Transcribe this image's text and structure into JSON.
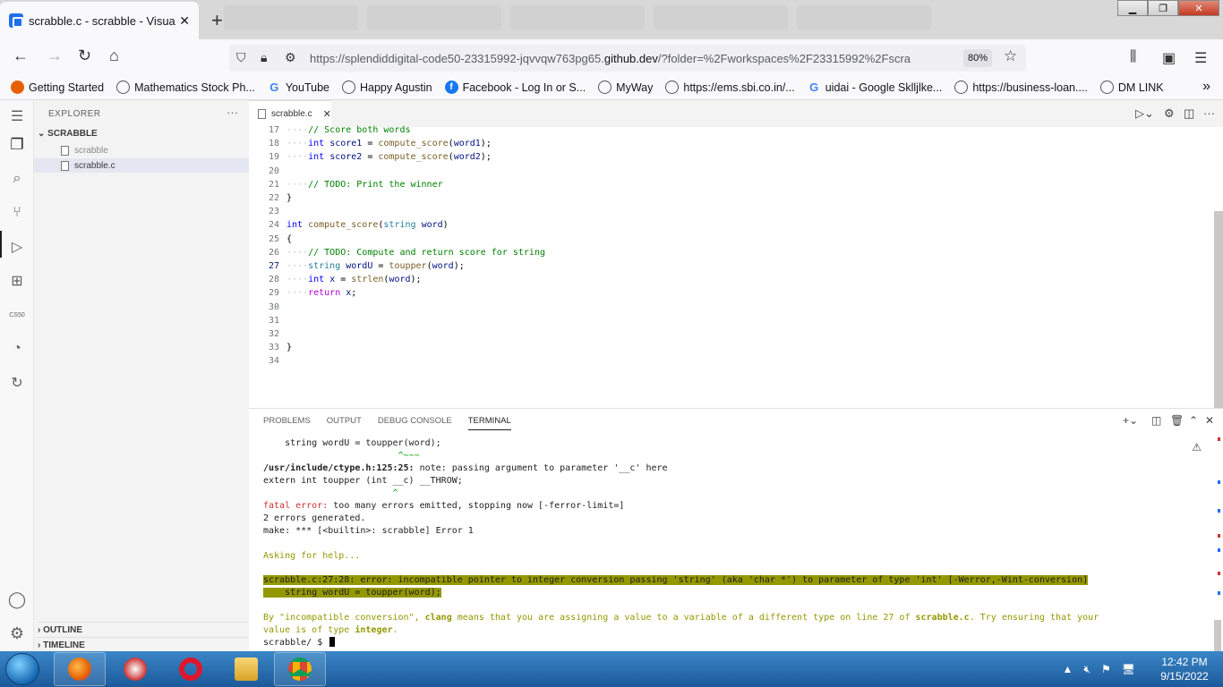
{
  "browser": {
    "tab_title": "scrabble.c - scrabble - Visual St",
    "url_prefix": "https://splendiddigital-code50-23315992-jqvvqw763pg65.",
    "url_domain": "github.dev",
    "url_suffix": "/?folder=%2Fworkspaces%2F23315992%2Fscra",
    "zoom": "80%"
  },
  "bookmarks": [
    {
      "label": "Getting Started",
      "icon": "firefox-icon",
      "color": "#e66000"
    },
    {
      "label": "Mathematics Stock Ph...",
      "icon": "globe-icon",
      "color": "#555555"
    },
    {
      "label": "YouTube",
      "icon": "google-icon",
      "color": "#4285f4"
    },
    {
      "label": "Happy Agustin",
      "icon": "globe-icon",
      "color": "#555555"
    },
    {
      "label": "Facebook - Log In or S...",
      "icon": "facebook-icon",
      "color": "#1877f2"
    },
    {
      "label": "MyWay",
      "icon": "globe-icon",
      "color": "#555555"
    },
    {
      "label": "https://ems.sbi.co.in/...",
      "icon": "globe-icon",
      "color": "#555555"
    },
    {
      "label": "uidai - Google Sklljlke...",
      "icon": "google-icon",
      "color": "#4285f4"
    },
    {
      "label": "https://business-loan....",
      "icon": "globe-icon",
      "color": "#555555"
    },
    {
      "label": "DM LINK",
      "icon": "globe-icon",
      "color": "#555555"
    }
  ],
  "explorer": {
    "title": "EXPLORER",
    "folder": "SCRABBLE",
    "files": [
      "scrabble",
      "scrabble.c"
    ],
    "outline": "OUTLINE",
    "timeline": "TIMELINE",
    "activity_label": "CS50"
  },
  "editor": {
    "tab": "scrabble.c"
  },
  "code_lines": [
    {
      "n": "17",
      "indent": "····",
      "parts": [
        [
          "cm",
          "// Score both words"
        ]
      ]
    },
    {
      "n": "18",
      "indent": "····",
      "parts": [
        [
          "kw",
          "int "
        ],
        [
          "var",
          "score1"
        ],
        [
          "tx",
          " = "
        ],
        [
          "fn",
          "compute_score"
        ],
        [
          "tx",
          "("
        ],
        [
          "var",
          "word1"
        ],
        [
          "tx",
          ");"
        ]
      ]
    },
    {
      "n": "19",
      "indent": "····",
      "parts": [
        [
          "kw",
          "int "
        ],
        [
          "var",
          "score2"
        ],
        [
          "tx",
          " = "
        ],
        [
          "fn",
          "compute_score"
        ],
        [
          "tx",
          "("
        ],
        [
          "var",
          "word2"
        ],
        [
          "tx",
          ");"
        ]
      ]
    },
    {
      "n": "20",
      "indent": "",
      "parts": []
    },
    {
      "n": "21",
      "indent": "····",
      "parts": [
        [
          "cm",
          "// TODO: Print the winner"
        ]
      ]
    },
    {
      "n": "22",
      "indent": "",
      "parts": [
        [
          "tx",
          "}"
        ]
      ]
    },
    {
      "n": "23",
      "indent": "",
      "parts": []
    },
    {
      "n": "24",
      "indent": "",
      "parts": [
        [
          "kw",
          "int "
        ],
        [
          "fn",
          "compute_score"
        ],
        [
          "tx",
          "("
        ],
        [
          "ty",
          "string "
        ],
        [
          "var",
          "word"
        ],
        [
          "tx",
          ")"
        ]
      ]
    },
    {
      "n": "25",
      "indent": "",
      "parts": [
        [
          "tx",
          "{"
        ]
      ]
    },
    {
      "n": "26",
      "indent": "····",
      "parts": [
        [
          "cm",
          "// TODO: Compute and return score for string"
        ]
      ]
    },
    {
      "n": "27",
      "indent": "····",
      "parts": [
        [
          "ty",
          "string "
        ],
        [
          "var",
          "wordU"
        ],
        [
          "tx",
          " = "
        ],
        [
          "fn",
          "toupper"
        ],
        [
          "tx",
          "("
        ],
        [
          "var",
          "word"
        ],
        [
          "tx",
          ");"
        ]
      ]
    },
    {
      "n": "28",
      "indent": "····",
      "parts": [
        [
          "kw",
          "int "
        ],
        [
          "var",
          "x"
        ],
        [
          "tx",
          " = "
        ],
        [
          "fn",
          "strlen"
        ],
        [
          "tx",
          "("
        ],
        [
          "var",
          "word"
        ],
        [
          "tx",
          ");"
        ]
      ]
    },
    {
      "n": "29",
      "indent": "····",
      "parts": [
        [
          "ctl",
          "return "
        ],
        [
          "var",
          "x"
        ],
        [
          "tx",
          ";"
        ]
      ]
    },
    {
      "n": "30",
      "indent": "",
      "parts": []
    },
    {
      "n": "31",
      "indent": "",
      "parts": []
    },
    {
      "n": "32",
      "indent": "",
      "parts": []
    },
    {
      "n": "33",
      "indent": "",
      "parts": [
        [
          "tx",
          "}"
        ]
      ]
    },
    {
      "n": "34",
      "indent": "",
      "parts": []
    }
  ],
  "panel": {
    "tabs": [
      "PROBLEMS",
      "OUTPUT",
      "DEBUG CONSOLE",
      "TERMINAL"
    ],
    "active_tab": "TERMINAL"
  },
  "terminal_lines": [
    {
      "parts": [
        [
          "",
          "    string wordU = toupper(word);"
        ]
      ]
    },
    {
      "parts": [
        [
          "grn",
          "                         ^~~~"
        ]
      ]
    },
    {
      "parts": [
        [
          "b",
          "/usr/include/ctype.h:125:25: "
        ],
        [
          "",
          "note: passing argument to parameter '__c' here"
        ]
      ]
    },
    {
      "parts": [
        [
          "",
          "extern int toupper (int __c) __THROW;"
        ]
      ]
    },
    {
      "parts": [
        [
          "grn",
          "                        ^"
        ]
      ]
    },
    {
      "parts": [
        [
          "red",
          "fatal error: "
        ],
        [
          "",
          "too many errors emitted, stopping now [-ferror-limit=]"
        ]
      ]
    },
    {
      "parts": [
        [
          "",
          "2 errors generated."
        ]
      ]
    },
    {
      "parts": [
        [
          "",
          "make: *** [<builtin>: scrabble] Error 1"
        ]
      ]
    },
    {
      "parts": []
    },
    {
      "parts": [
        [
          "olive",
          "Asking for help..."
        ]
      ]
    },
    {
      "parts": []
    },
    {
      "parts": [
        [
          "olivebg",
          "scrabble.c:27:28: error: incompatible pointer to integer conversion passing 'string' (aka 'char *') to parameter of type 'int' [-Werror,-Wint-conversion]"
        ]
      ]
    },
    {
      "parts": [
        [
          "olivebg",
          "    string wordU = toupper(word);"
        ]
      ]
    },
    {
      "parts": []
    },
    {
      "parts": [
        [
          "olive",
          "By \"incompatible conversion\", "
        ],
        [
          "olive b",
          "clang"
        ],
        [
          "olive",
          " means that you are assigning a value to a variable of a different type on line 27 of "
        ],
        [
          "olive b",
          "scrabble.c"
        ],
        [
          "olive",
          ". Try ensuring that your"
        ]
      ]
    },
    {
      "parts": [
        [
          "olive",
          "value is of type "
        ],
        [
          "olive b",
          "integer"
        ],
        [
          "olive",
          "."
        ]
      ]
    },
    {
      "parts": [
        [
          "",
          "scrabble/ $ "
        ]
      ]
    }
  ],
  "taskbar": {
    "time": "12:42 PM",
    "date": "9/15/2022"
  }
}
